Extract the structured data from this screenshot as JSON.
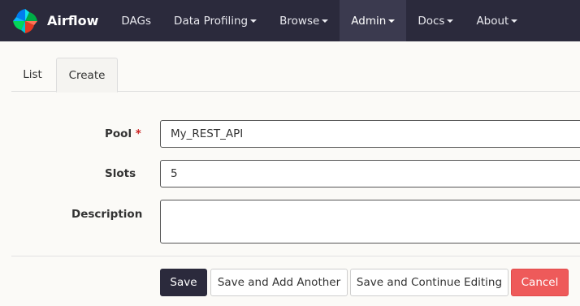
{
  "navbar": {
    "brand": "Airflow",
    "items": [
      {
        "label": "DAGs",
        "has_caret": false
      },
      {
        "label": "Data Profiling",
        "has_caret": true
      },
      {
        "label": "Browse",
        "has_caret": true
      },
      {
        "label": "Admin",
        "has_caret": true,
        "active": true
      },
      {
        "label": "Docs",
        "has_caret": true
      },
      {
        "label": "About",
        "has_caret": true
      }
    ],
    "background": "#2b2a3c"
  },
  "tabs": [
    {
      "label": "List"
    },
    {
      "label": "Create",
      "active": true
    }
  ],
  "form": {
    "pool": {
      "label": "Pool",
      "required_marker": "*",
      "value": "My_REST_API"
    },
    "slots": {
      "label": "Slots",
      "value": "5"
    },
    "description": {
      "label": "Description",
      "value": ""
    }
  },
  "buttons": {
    "save": "Save",
    "save_add": "Save and Add Another",
    "save_continue": "Save and Continue Editing",
    "cancel": "Cancel"
  },
  "colors": {
    "save": "#2b2a3c",
    "cancel": "#ee5a5a",
    "required": "#cc2222"
  }
}
